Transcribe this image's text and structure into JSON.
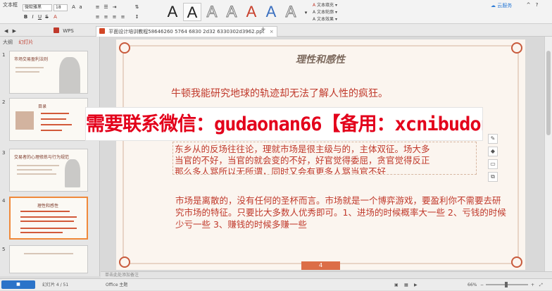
{
  "ribbon": {
    "left_label": "文本框",
    "font_name": "微软雅黑",
    "font_size": "18",
    "style_glyph": "A",
    "text_fill_label": "文本填充",
    "text_outline_label": "文本轮廓",
    "text_effect_label": "文本效果",
    "cloud_label": "云服务"
  },
  "tabs": {
    "wps_tab": "WPS",
    "doc_tab": "平面设计培训教程58646260 5764 6830 2d32 6330302d3962.ppt"
  },
  "thumbnails": {
    "pane_tab_outline": "大纲",
    "pane_tab_slides": "幻灯片",
    "items": [
      {
        "num": "1",
        "title": "市场交易盈利法则"
      },
      {
        "num": "2",
        "title": "目录"
      },
      {
        "num": "3",
        "title": "交易者的心理修炼与行为规范"
      },
      {
        "num": "4",
        "title": "理性和感性"
      },
      {
        "num": "5",
        "title": ""
      }
    ]
  },
  "slide": {
    "title": "理性和感性",
    "quote": "牛顿我能研究地球的轨迹却无法了解人性的疯狂。",
    "box_lines": [
      "东乡从的反场往往论，理就市场是很主级与的，主体双征。场大多",
      "当官的不好，当官的就会变的不好，好官觉得委屈，贪官觉得反正",
      "那么多人骂所以无所谓，同时又会有更多人骂当官不好"
    ],
    "paragraph": "市场是离散的，没有任何的圣杯而言。市场就是一个博弈游戏，要盈利你不需要去研究市场的特征。只要比大多数人优秀即可。1、进场的时候概率大一些 2、亏钱的时候少亏一些 3、赚钱的时候多赚一些",
    "page_number": "4"
  },
  "watermark": {
    "text": "需要联系微信：gudaonan66【备用：xcnibudong0105】"
  },
  "notes_placeholder": "单击此处添加备注",
  "status": {
    "slide_info": "幻灯片 4 / 51",
    "theme": "Office 主题",
    "zoom": "66%"
  },
  "colors": {
    "accent": "#c0392b",
    "frame": "#e8d4c6",
    "page_badge": "#dc6e47",
    "watermark": "#e3001b"
  }
}
